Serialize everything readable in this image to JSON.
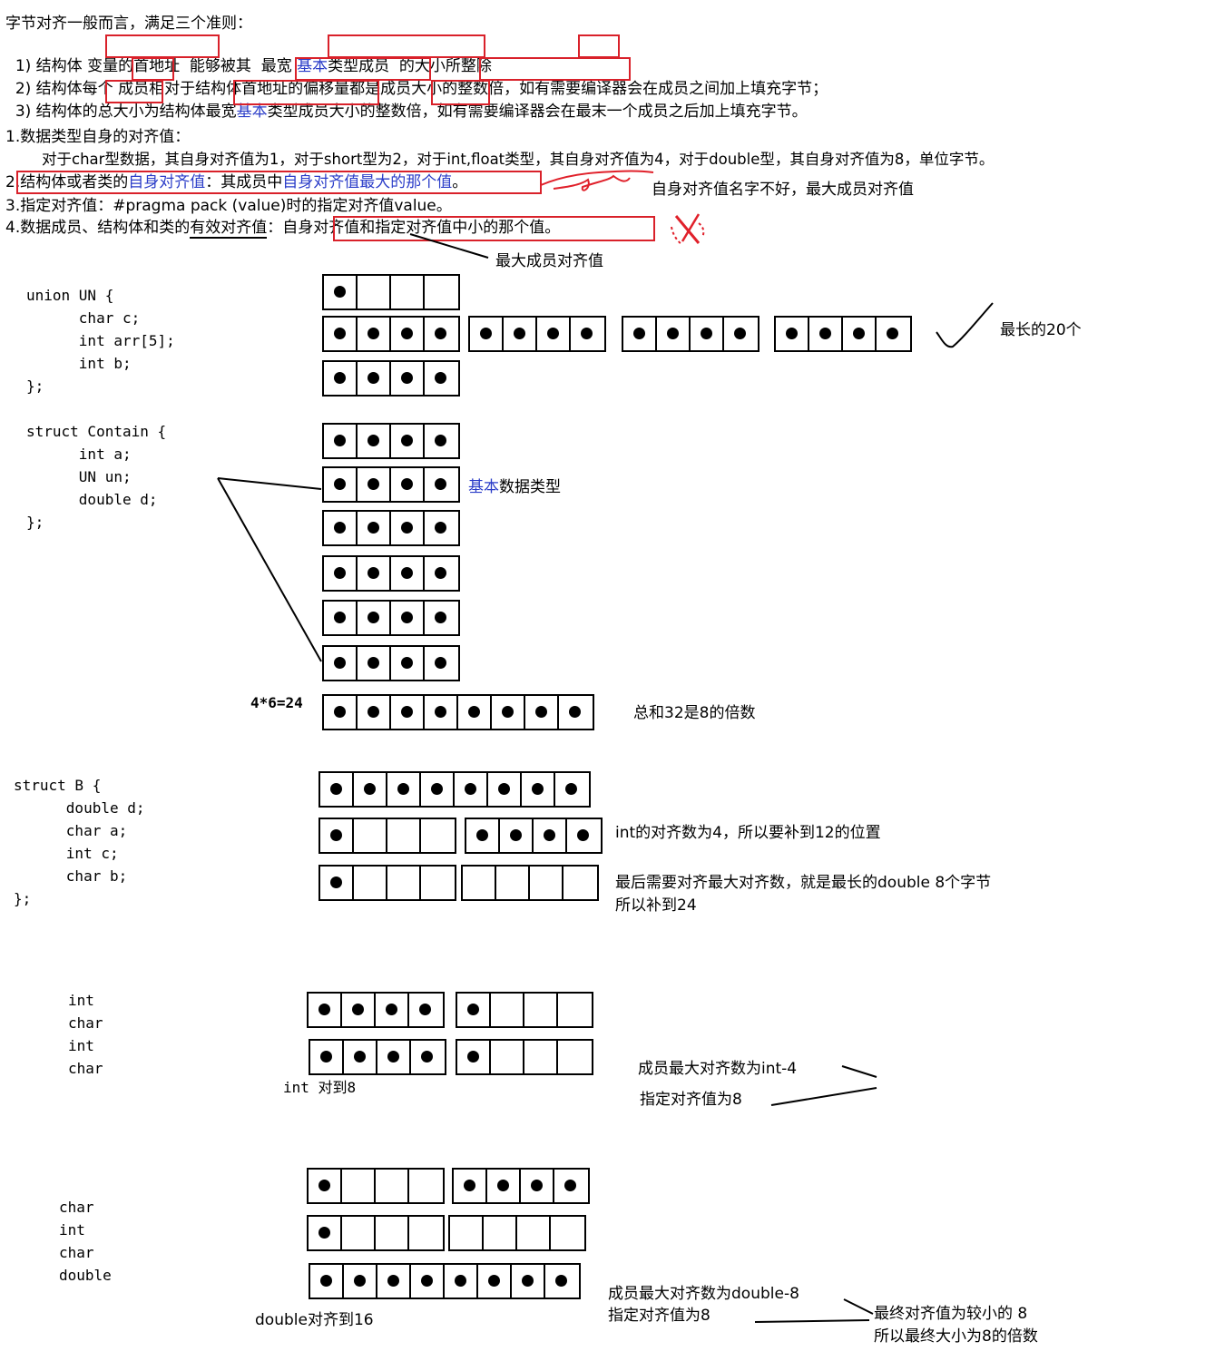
{
  "rules": {
    "title": "字节对齐一般而言，满足三个准则：",
    "rule1": {
      "p1": "1) 结构体 ",
      "b1": "变量的首地址",
      "p2": "  能够被其  ",
      "b2a": "最宽 ",
      "b2blue": "基本",
      "b2b": "类型成员",
      "p3": "  的大小所",
      "b3": "整除"
    },
    "rule2": {
      "p1": "2) 结构体每个 ",
      "b1": "成员",
      "p2": "相对于结构体",
      "b2": "首地址的偏移量",
      "p3": "都是",
      "b3": "成员大小的整数倍",
      "p4": "，如有需要编译器会在成员之间加上填充字节；"
    },
    "rule3": {
      "p1": "3) 结构体的",
      "b1": "总大小",
      "p2": "为结构体",
      "b2a": "最宽",
      "b2blue": "基本",
      "b2b": "类型成员",
      "p3": "大小的",
      "b3": "整数倍",
      "p4": "，如有需要编译器会在最末一个成员之后加上填充字节。"
    }
  },
  "alignment": {
    "item1": "1.数据类型自身的对齐值：",
    "item1_detail": "对于char型数据，其自身对齐值为1，对于short型为2，对于int,float类型，其自身对齐值为4，对于double型，其自身对齐值为8，单位字节。",
    "item2": {
      "a": "2.",
      "b": "结构体或者类的",
      "c": "自身对齐值",
      "d": "：其成员中",
      "e": "自身对齐值最大的那个值",
      "f": "。"
    },
    "item2_note": "自身对齐值名字不好，最大成员对齐值",
    "item3": "3.指定对齐值：#pragma pack (value)时的指定对齐值value。",
    "item4": {
      "a": "4.数据成员、结构体和类的",
      "b": "有效对齐值",
      "c": "：",
      "d": "自身对齐值和指定对齐值中小的那个值",
      "e": "。"
    },
    "item4_note": "最大成员对齐值"
  },
  "union_example": {
    "code": [
      "union UN {",
      "      char c;",
      "      int arr[5];",
      "      int b;",
      "};"
    ],
    "note": "最长的20个"
  },
  "struct_contain": {
    "code": [
      "struct Contain {",
      "      int a;",
      "      UN un;",
      "      double d;",
      "};"
    ],
    "note_blue": "基本",
    "note_rest": "数据类型",
    "calc": "4*6=24",
    "sum_note": "总和32是8的倍数"
  },
  "struct_b": {
    "code": [
      "struct B {",
      "      double d;",
      "      char a;",
      "      int c;",
      "      char b;",
      "};"
    ],
    "note1": "int的对齐数为4，所以要补到12的位置",
    "note2a": "最后需要对齐最大对齐数，就是最长的double 8个字节",
    "note2b": "所以补到24"
  },
  "example3": {
    "types": [
      "int",
      "char",
      "int",
      "char"
    ],
    "caption": "int 对到8",
    "note1": "成员最大对齐数为int-4",
    "note2": "指定对齐值为8"
  },
  "example4": {
    "types": [
      "char",
      "int",
      "char",
      "double"
    ],
    "caption": "double对齐到16",
    "note1": "成员最大对齐数为double-8",
    "note2": "指定对齐值为8",
    "result1": "最终对齐值为较小的 8",
    "result2": "所以最终大小为8的倍数"
  },
  "colors": {
    "box_red": "#d9212a",
    "blue_text": "#2a3cc8",
    "pen_red": "#e0202a"
  }
}
